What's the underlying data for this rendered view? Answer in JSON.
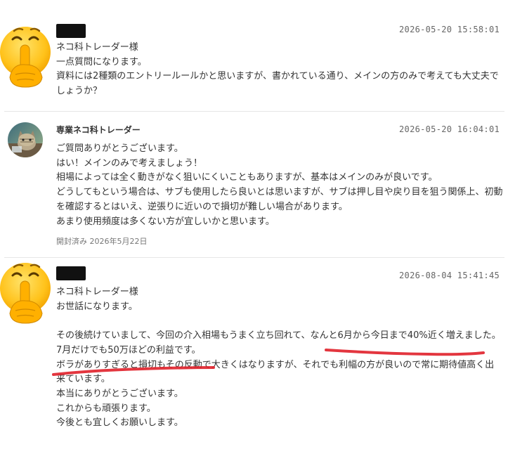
{
  "messages": [
    {
      "sender_redacted": true,
      "timestamp": "2026-05-20 15:58:01",
      "lines": [
        "ネコ科トレーダー様",
        "一点質問になります。",
        "資料には2種類のエントリールールかと思いますが、書かれている通り、メインの方のみで考えても大丈夫でしょうか？"
      ]
    },
    {
      "sender": "専業ネコ科トレーダー",
      "timestamp": "2026-05-20 16:04:01",
      "lines": [
        "ご質問ありがとうございます。",
        "はい！メインのみで考えましょう！",
        "相場によっては全く動きがなく狙いにくいこともありますが、基本はメインのみが良いです。",
        "どうしてもという場合は、サブも使用したら良いとは思いますが、サブは押し目や戻り目を狙う関係上、初動を確認するとはいえ、逆張りに近いので損切が難しい場合があります。",
        "あまり使用頻度は多くない方が宜しいかと思います。"
      ],
      "read_status": "開封済み 2026年5月22日"
    },
    {
      "sender_redacted": true,
      "timestamp": "2026-08-04 15:41:45",
      "lines": [
        "ネコ科トレーダー様",
        "お世話になります。",
        "",
        "その後続けていまして、今回の介入相場もうまく立ち回れて、なんと6月から今日まで40%近く増えました。",
        "7月だけでも50万ほどの利益です。",
        "ボラがありすぎると損切もその反動で大きくはなりますが、それでも利幅の方が良いので常に期待値高く出来ています。",
        "本当にありがとうございます。",
        "これからも頑張ります。",
        "今後とも宜しくお願いします。"
      ]
    }
  ],
  "icons": {
    "avatar_user": "shushing-face-emoji",
    "avatar_trader": "cat-trader-avatar"
  },
  "colors": {
    "highlight": "#e0202a",
    "divider": "#e6e6e6",
    "text": "#333333",
    "meta": "#666666"
  }
}
